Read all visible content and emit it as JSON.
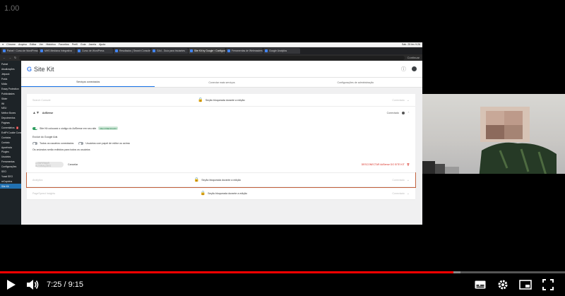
{
  "player": {
    "speed_label": "1.00",
    "current_time": "7:25",
    "duration": "9:15",
    "time_separator": "/",
    "played_fraction": 0.802,
    "buffered_fraction": 0.815,
    "accent_color": "#ff0000"
  },
  "macbar": {
    "items": [
      "Chrome",
      "Arquivo",
      "Editar",
      "Ver",
      "Histórico",
      "Favoritos",
      "Perfil",
      "Guia",
      "Janela",
      "Ajuda"
    ],
    "clock": "Sáb. 25 fev 9:26"
  },
  "browser": {
    "tabs": [
      {
        "label": "Painel ‹ Curso de WordPress",
        "active": false
      },
      {
        "label": "MHS Medicina Integrativa",
        "active": false
      },
      {
        "label": "Curso de WordPress",
        "active": false
      },
      {
        "label": "Resultados | Search Console",
        "active": false
      },
      {
        "label": "GA4 - Guia para Iniciantes",
        "active": false
      },
      {
        "label": "Site Kit by Google › Configurações",
        "active": true
      },
      {
        "label": "Ferramentas de Webmasters",
        "active": false
      },
      {
        "label": "Google Analytics",
        "active": false
      }
    ],
    "url": "",
    "profile": "Continuar"
  },
  "wp_sidebar": {
    "items": [
      {
        "label": "Painel",
        "current": false
      },
      {
        "label": "Atualizações",
        "current": false
      },
      {
        "label": "Jetpack",
        "current": false
      },
      {
        "label": "Posts",
        "current": false
      },
      {
        "label": "Mídia",
        "current": false
      },
      {
        "label": "Essay Protection",
        "current": false
      },
      {
        "label": "Publicidades",
        "current": false
      },
      {
        "label": "Slider",
        "current": false
      },
      {
        "label": "Wt",
        "current": false
      },
      {
        "label": "MEU",
        "current": false
      },
      {
        "label": "Melhor Boxes",
        "current": false
      },
      {
        "label": "Depoimentos",
        "current": false
      },
      {
        "label": "Páginas",
        "current": false
      },
      {
        "label": "Comentários",
        "current": false,
        "badge": "2"
      },
      {
        "label": "ExitPt Cookie Consent",
        "current": false
      },
      {
        "label": "Contatos",
        "current": false
      },
      {
        "label": "Contato",
        "current": false
      },
      {
        "label": "Aparência",
        "current": false
      },
      {
        "label": "Plugins",
        "current": false
      },
      {
        "label": "Usuários",
        "current": false
      },
      {
        "label": "Ferramentas",
        "current": false
      },
      {
        "label": "Configurações",
        "current": false
      },
      {
        "label": "SEO",
        "current": false
      },
      {
        "label": "Yoast SEO",
        "current": false
      },
      {
        "label": "reCaptcha",
        "current": false
      },
      {
        "label": "Site Kit",
        "current": true
      }
    ]
  },
  "sitekit": {
    "brand": "G",
    "title": "Site Kit",
    "tabs": [
      {
        "label": "Serviços conectados",
        "active": true
      },
      {
        "label": "Conectar mais serviços",
        "active": false
      },
      {
        "label": "Configurações de administração",
        "active": false
      }
    ],
    "rows": [
      {
        "name": "Search Console",
        "lock_text": "Seção bloqueada durante a edição",
        "status": "Conectado"
      },
      {
        "name": "AdSense",
        "status": "Conectado"
      },
      {
        "name": "Analytics",
        "lock_text": "Seção bloqueada durante a edição",
        "status": "Conectado"
      },
      {
        "name": "PageSpeed Insights",
        "lock_text": "Seção bloqueada durante a edição",
        "status": "Conectado"
      }
    ],
    "adsense": {
      "toggle_text": "Site Kit colocará o código do AdSense em seu site",
      "toggle_chip": "RECOMENDADO",
      "subheading": "Excluir do Google Ads",
      "opt1": "Todos os usuários conectados",
      "opt2": "Usuários com papel de editor ou acima",
      "note": "Os anúncios serão exibidos para todos os usuários",
      "confirm_button": "CONFIRMAR ALTERAÇÕES",
      "cancel": "Cancelar",
      "disconnect": "DESCONECTAR AdSense DO SITE KIT"
    }
  }
}
